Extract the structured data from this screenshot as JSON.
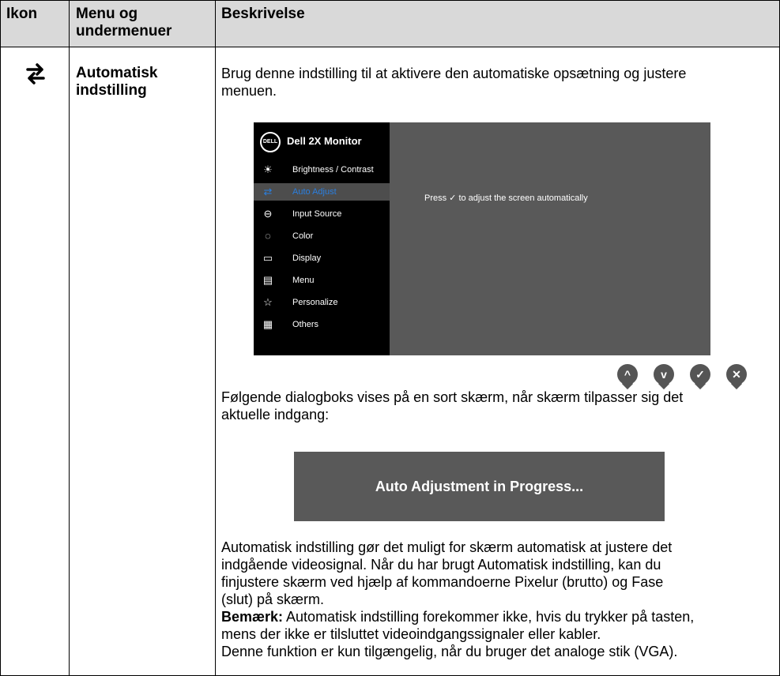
{
  "table": {
    "headers": {
      "icon": "Ikon",
      "menu_line1": "Menu og",
      "menu_line2": "undermenuer",
      "description": "Beskrivelse"
    },
    "row": {
      "icon_name": "auto-adjust-icon",
      "name_line1": "Automatisk",
      "name_line2": "indstilling",
      "desc_line1": "Brug denne indstilling til at aktivere den automatiske opsætning og justere",
      "desc_line2": "menuen.",
      "following_line1": "Følgende dialogboks vises på en sort skærm, når skærm tilpasser sig det",
      "following_line2": "aktuelle indgang:",
      "body_line1": "Automatisk indstilling gør det muligt for skærm automatisk at justere det",
      "body_line2": "indgående videosignal. Når du har brugt Automatisk indstilling, kan du",
      "body_line3": "finjustere skærm ved hjælp af kommandoerne Pixelur (brutto) og Fase",
      "body_line4": "(slut) på skærm.",
      "note_label": "Bemærk:",
      "note_line1": " Automatisk indstilling forekommer ikke, hvis du trykker på tasten,",
      "note_line2": "mens der ikke er tilsluttet videoindgangssignaler eller kabler.",
      "last_line": "Denne funktion er kun tilgængelig, når du bruger det analoge stik (VGA)."
    }
  },
  "osd": {
    "logo": "DELL",
    "title": "Dell 2X Monitor",
    "menu": [
      {
        "icon": "brightness-icon",
        "glyph": "☀",
        "label": "Brightness / Contrast",
        "selected": false
      },
      {
        "icon": "auto-adjust-icon",
        "glyph": "⇄",
        "label": "Auto Adjust",
        "selected": true
      },
      {
        "icon": "input-source-icon",
        "glyph": "⊖",
        "label": "Input Source",
        "selected": false
      },
      {
        "icon": "color-icon",
        "glyph": "◌",
        "label": "Color",
        "selected": false
      },
      {
        "icon": "display-icon",
        "glyph": "▭",
        "label": "Display",
        "selected": false
      },
      {
        "icon": "menu-icon",
        "glyph": "▤",
        "label": "Menu",
        "selected": false
      },
      {
        "icon": "star-icon",
        "glyph": "☆",
        "label": "Personalize",
        "selected": false
      },
      {
        "icon": "others-icon",
        "glyph": "▦",
        "label": "Others",
        "selected": false
      }
    ],
    "message": "Press ✓ to adjust the screen automatically",
    "buttons": [
      {
        "icon": "up-icon",
        "glyph": "^"
      },
      {
        "icon": "down-icon",
        "glyph": "v"
      },
      {
        "icon": "check-icon",
        "glyph": "✓"
      },
      {
        "icon": "close-icon",
        "glyph": "✕"
      }
    ]
  },
  "dialog": {
    "text": "Auto Adjustment in Progress..."
  },
  "colors": {
    "osd_bg": "#595959",
    "osd_sidebar": "#000000",
    "selected_text": "#2a7fe0",
    "header_bg": "#d9d9d9"
  }
}
